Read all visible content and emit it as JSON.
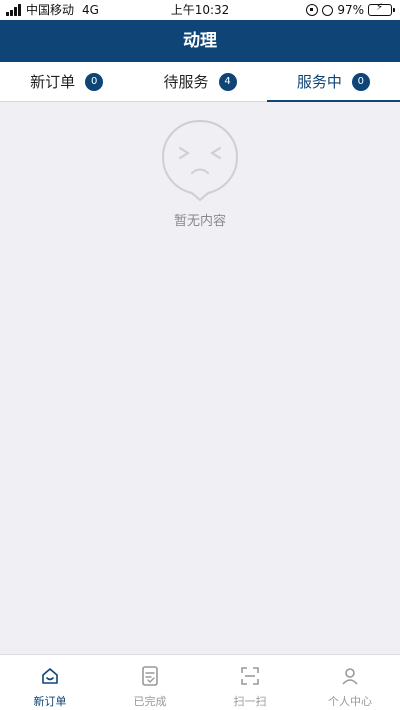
{
  "status_bar": {
    "carrier": "中国移动",
    "network": "4G",
    "time": "上午10:32",
    "battery": "97%",
    "battery_level": 0.97
  },
  "nav": {
    "title": "动理"
  },
  "tabs": [
    {
      "label": "新订单",
      "count": "0"
    },
    {
      "label": "待服务",
      "count": "4"
    },
    {
      "label": "服务中",
      "count": "0"
    }
  ],
  "active_tab": "服务中",
  "empty": {
    "text": "暂无内容",
    "icon": "sad-face-icon"
  },
  "tabbar": [
    {
      "label": "新订单",
      "icon": "home-icon"
    },
    {
      "label": "已完成",
      "icon": "document-icon"
    },
    {
      "label": "扫一扫",
      "icon": "scan-icon"
    },
    {
      "label": "个人中心",
      "icon": "person-icon"
    }
  ],
  "colors": {
    "primary": "#0e4476",
    "background": "#efeff4",
    "battery": "#31c73b"
  }
}
